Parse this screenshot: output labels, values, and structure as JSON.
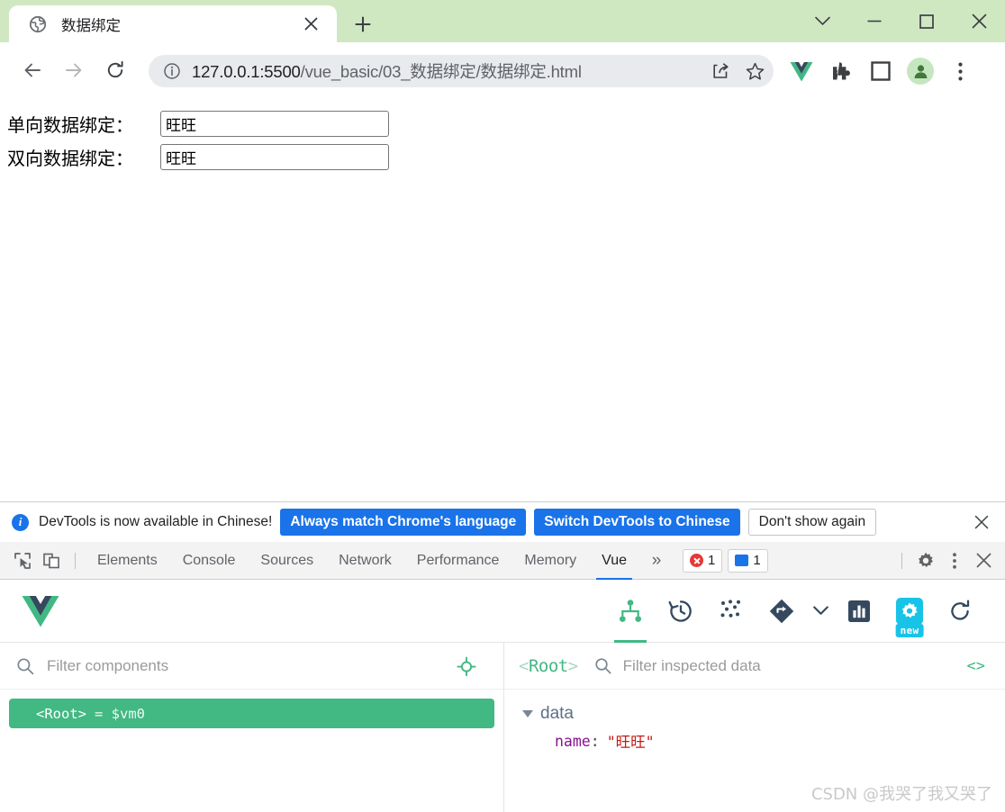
{
  "browser": {
    "tab": {
      "title": "数据绑定",
      "favicon_icon": "globe-icon",
      "close_icon": "close-icon"
    },
    "new_tab_label": "+",
    "window_controls": {
      "tab_search_icon": "chevron-down-icon",
      "minimize_label": "—",
      "maximize_icon": "square-icon",
      "close_label": "✕"
    },
    "nav": {
      "back_icon": "arrow-left-icon",
      "forward_icon": "arrow-right-icon",
      "reload_icon": "reload-icon"
    },
    "omnibox": {
      "info_icon": "info-circle-icon",
      "url_host": "127.0.0.1:5500",
      "url_path": "/vue_basic/03_数据绑定/数据绑定.html",
      "share_icon": "share-icon",
      "bookmark_icon": "star-icon"
    },
    "extensions": [
      {
        "name": "vue-devtools-icon",
        "label": "V"
      },
      {
        "name": "puzzle-icon",
        "label": ""
      },
      {
        "name": "sidebar-icon",
        "label": ""
      }
    ],
    "profile": {
      "avatar_icon": "person-icon"
    },
    "menu_icon": "three-dots-vertical-icon"
  },
  "page": {
    "rows": [
      {
        "label": "单向数据绑定：",
        "value": "旺旺"
      },
      {
        "label": "双向数据绑定：",
        "value": "旺旺"
      }
    ]
  },
  "devtools": {
    "notification": {
      "info_icon": "info-icon",
      "info_label": "i",
      "message": "DevTools is now available in Chinese!",
      "buttons": [
        {
          "label": "Always match Chrome's language",
          "style": "primary"
        },
        {
          "label": "Switch DevTools to Chinese",
          "style": "primary"
        },
        {
          "label": "Don't show again",
          "style": "ghost"
        }
      ],
      "close_icon": "close-icon"
    },
    "inspect_icon": "inspect-element-icon",
    "device_toolbar_icon": "device-toolbar-icon",
    "tabs": [
      {
        "label": "Elements",
        "active": false
      },
      {
        "label": "Console",
        "active": false
      },
      {
        "label": "Sources",
        "active": false
      },
      {
        "label": "Network",
        "active": false
      },
      {
        "label": "Performance",
        "active": false
      },
      {
        "label": "Memory",
        "active": false
      },
      {
        "label": "Vue",
        "active": true
      }
    ],
    "overflow_label": "»",
    "badges": {
      "errors": "1",
      "messages": "1"
    },
    "settings_icon": "gear-icon",
    "more_icon": "three-dots-vertical-icon",
    "close_icon": "close-icon"
  },
  "vue_devtools": {
    "logo_icon": "vue-logo-icon",
    "toolbar": [
      {
        "name": "component-tree-icon",
        "active": true
      },
      {
        "name": "timeline-history-icon",
        "active": false
      },
      {
        "name": "vuex-dots-icon",
        "active": false
      },
      {
        "name": "router-icon",
        "active": false
      },
      {
        "name": "chevron-down-icon",
        "active": false
      },
      {
        "name": "performance-bars-icon",
        "active": false
      },
      {
        "name": "settings-gear-icon",
        "active": false,
        "badge": "new"
      },
      {
        "name": "refresh-icon",
        "active": false
      }
    ],
    "components_pane": {
      "filter_placeholder": "Filter components",
      "search_icon": "search-icon",
      "target_icon": "target-crosshair-icon",
      "tree": [
        {
          "tag": "<Root>",
          "alias": "= $vm0",
          "selected": true
        }
      ]
    },
    "inspector_pane": {
      "title_open": "<",
      "title_name": "Root",
      "title_close": ">",
      "filter_placeholder": "Filter inspected data",
      "search_icon": "search-icon",
      "code_icon_label": "<>",
      "groups": [
        {
          "name": "data",
          "expanded": true,
          "entries": [
            {
              "key": "name",
              "separator": ":",
              "value": "\"旺旺\""
            }
          ]
        }
      ]
    }
  },
  "watermark": "CSDN @我哭了我又哭了",
  "colors": {
    "tabstrip_green": "#cfe8c2",
    "vue_green": "#42b883",
    "chrome_blue": "#1a73e8",
    "badge_cyan": "#18c3e8",
    "error_red": "#e53935"
  }
}
